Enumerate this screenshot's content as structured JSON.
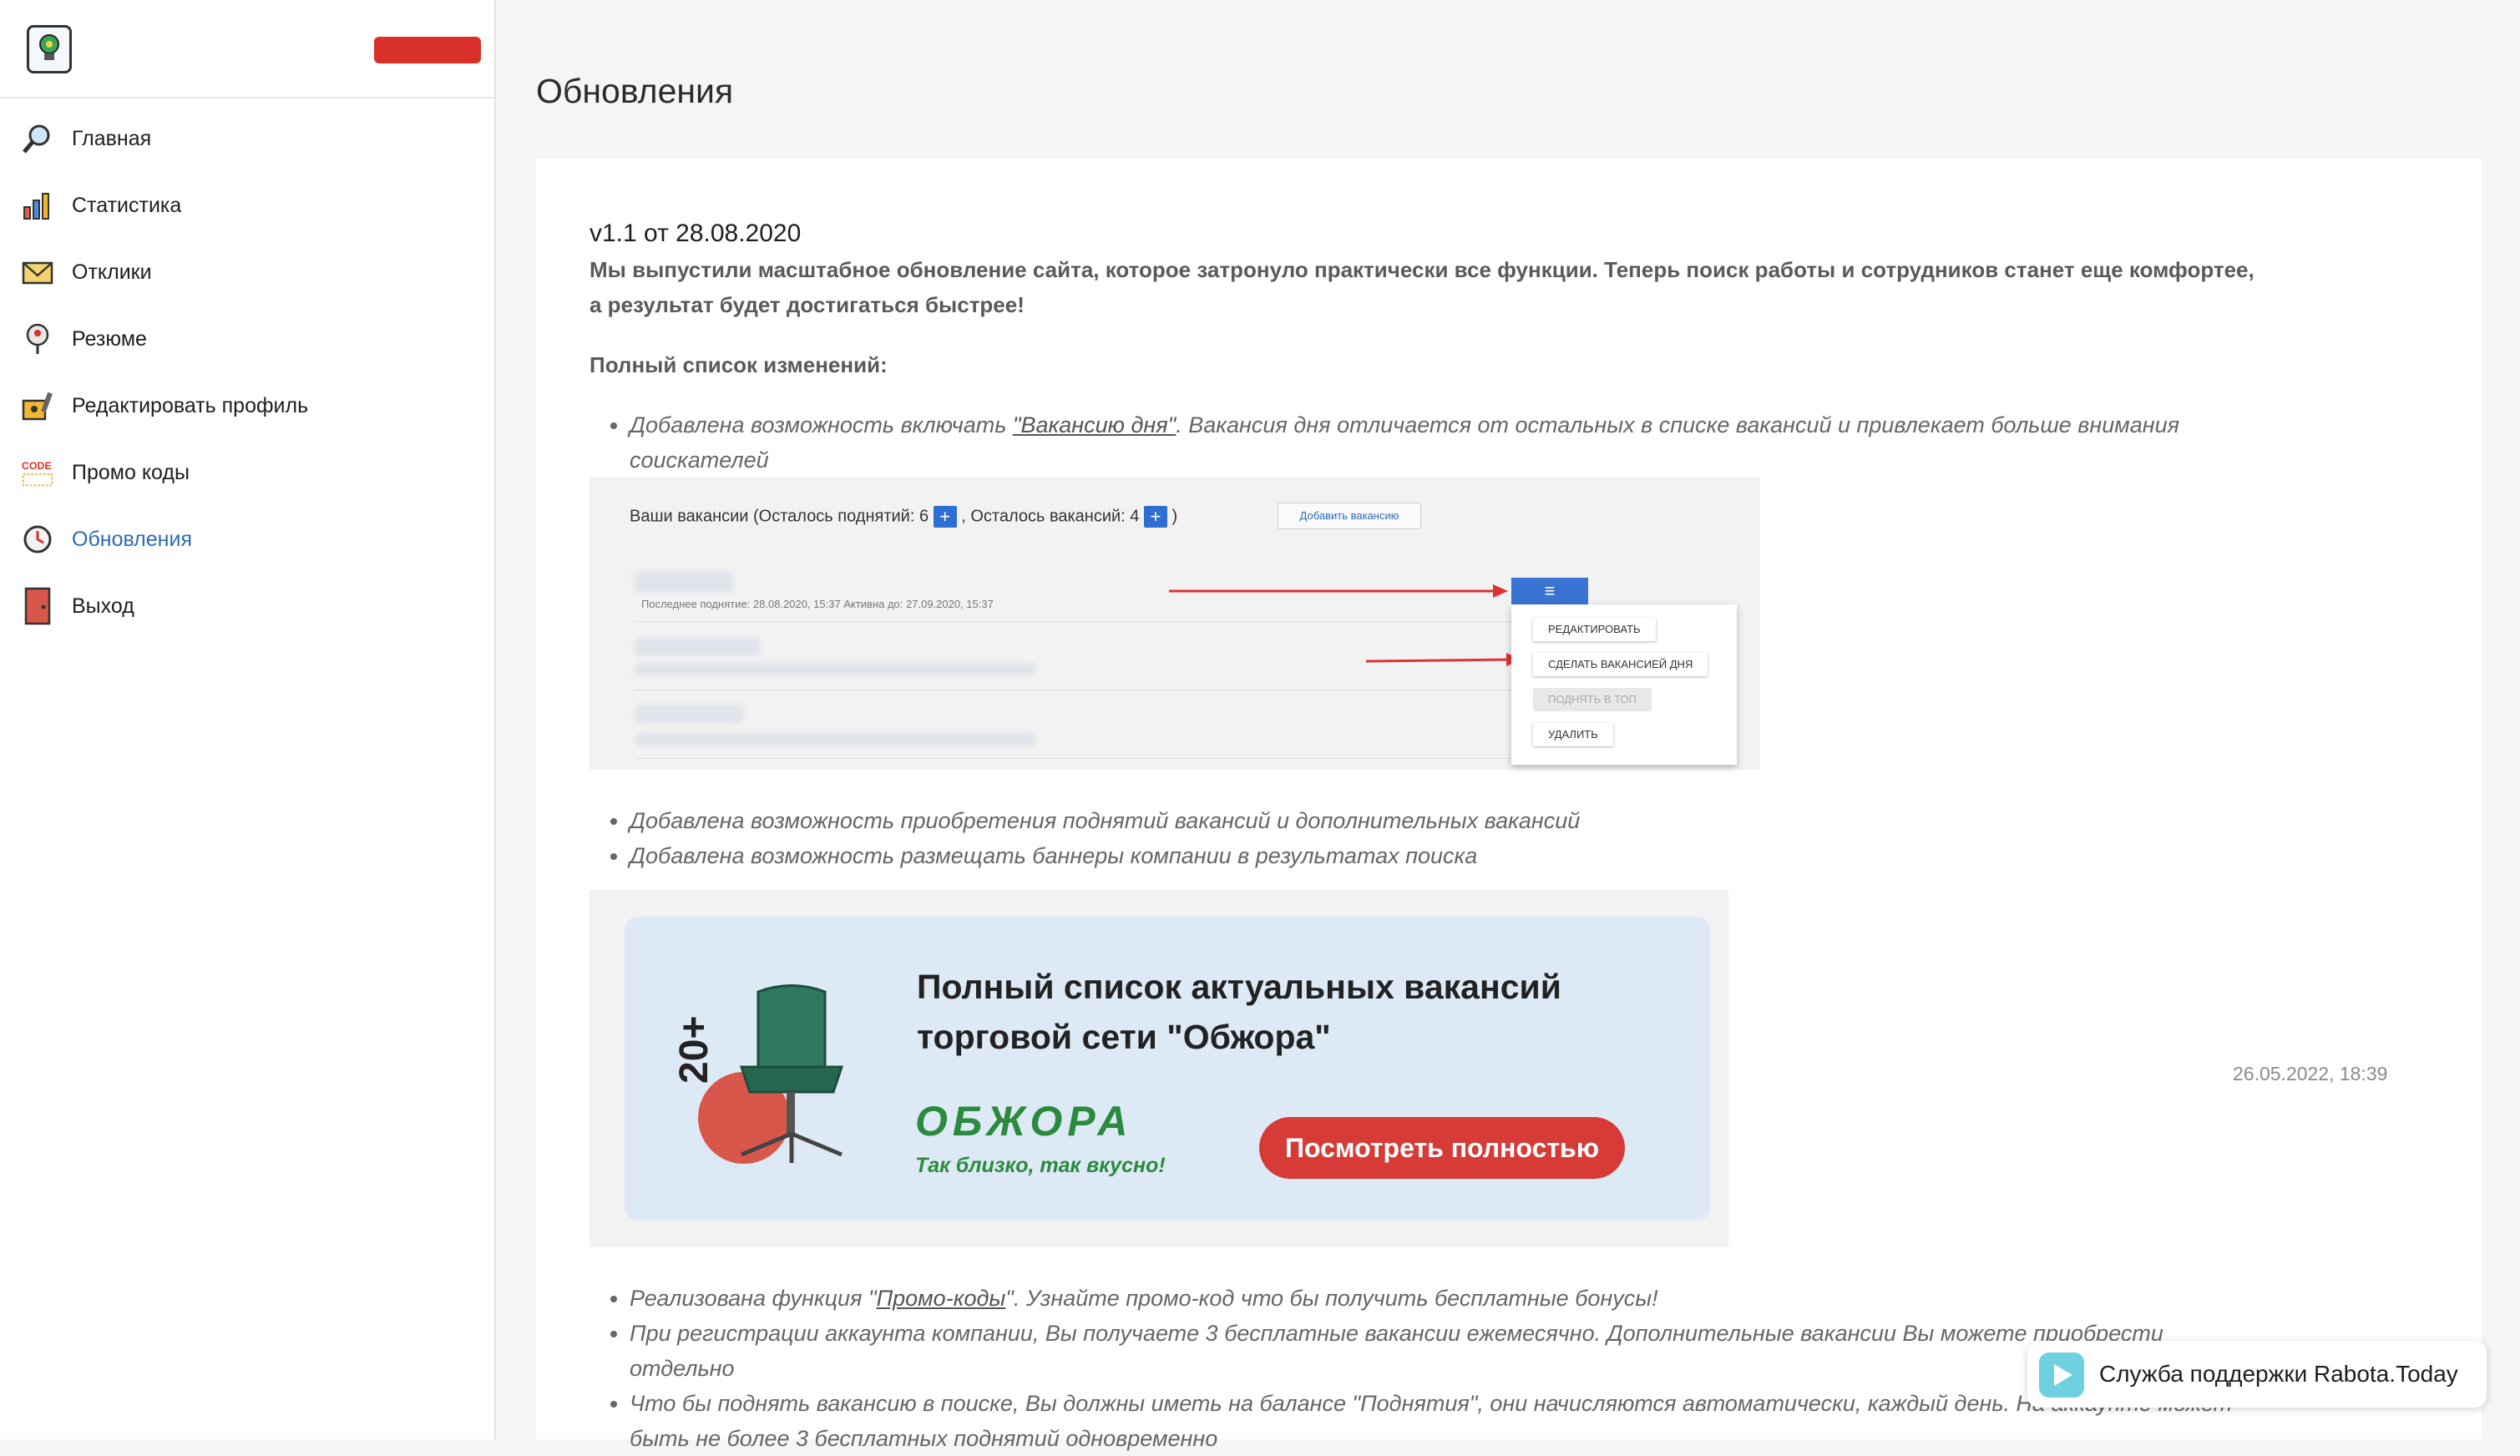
{
  "sidebar": {
    "items": [
      {
        "label": "Главная",
        "icon": "search-icon"
      },
      {
        "label": "Статистика",
        "icon": "stats-icon"
      },
      {
        "label": "Отклики",
        "icon": "mail-icon"
      },
      {
        "label": "Резюме",
        "icon": "resume-icon"
      },
      {
        "label": "Редактировать профиль",
        "icon": "edit-profile-icon"
      },
      {
        "label": "Промо коды",
        "icon": "code-icon"
      },
      {
        "label": "Обновления",
        "icon": "updates-icon",
        "active": true
      },
      {
        "label": "Выход",
        "icon": "door-icon"
      }
    ],
    "code_icon_text": "CODE"
  },
  "page": {
    "title": "Обновления"
  },
  "update": {
    "version": "v1.1 от 28.08.2020",
    "lead": "Мы выпустили масштабное обновление сайта, которое затронуло практически все функции. Теперь поиск работы и сотрудников станет еще комфортее, а результат будет достигаться быстрее!",
    "subhead": "Полный список изменений:",
    "item1_prefix": "Добавлена возможность включать ",
    "item1_link": "\"Вакансию дня\"",
    "item1_suffix": ". Вакансия дня отличается от остальных в списке вакансий и привлекает больше внимания соискателей",
    "item2": "Добавлена возможность приобретения поднятий вакансий и дополнительных вакансий",
    "item3": "Добавлена возможность размещать баннеры компании в результатах поиска",
    "item4_prefix": "Реализована функция \"",
    "item4_link": "Промо-коды",
    "item4_suffix": "\". Узнайте промо-код что бы получить бесплатные бонусы!",
    "item5": "При регистрации аккаунта компании, Вы получаете 3 бесплатные вакансии ежемесячно. Дополнительные вакансии Вы можете приобрести отдельно",
    "item6": "Что бы поднять вакансию в поиске, Вы должны иметь на балансе \"Поднятия\", они начисляются автоматически, каждый день. На аккаунте может быть не более 3 бесплатных поднятий одновременно",
    "timestamp": "26.05.2022, 18:39"
  },
  "screenshot1": {
    "title_a": "Ваши вакансии (Осталось поднятий: 6",
    "title_b": ", Осталось вакансий: 4",
    "title_c": ")",
    "plus": "+",
    "add_button": "Добавить вакансию",
    "note": "Последнее поднятие: 28.08.2020, 15:37 Активна до: 27.09.2020, 15:37",
    "menu_icon": "≡",
    "menu": [
      "РЕДАКТИРОВАТЬ",
      "СДЕЛАТЬ ВАКАНСИЕЙ ДНЯ",
      "ПОДНЯТЬ В ТОП",
      "УДАЛИТЬ"
    ]
  },
  "banner": {
    "line1": "Полный список актуальных вакансий",
    "line2": "торговой сети \"Обжора\"",
    "button": "Посмотреть полностью",
    "logo": "ОБЖОРА",
    "slogan": "Так близко, так вкусно!",
    "badge": "20+"
  },
  "support": {
    "label": "Служба поддержки Rabota.Today"
  },
  "colors": {
    "accent": "#2d6bb5",
    "brand_red": "#d63b37",
    "sidebar_badge": "#d9302a"
  }
}
